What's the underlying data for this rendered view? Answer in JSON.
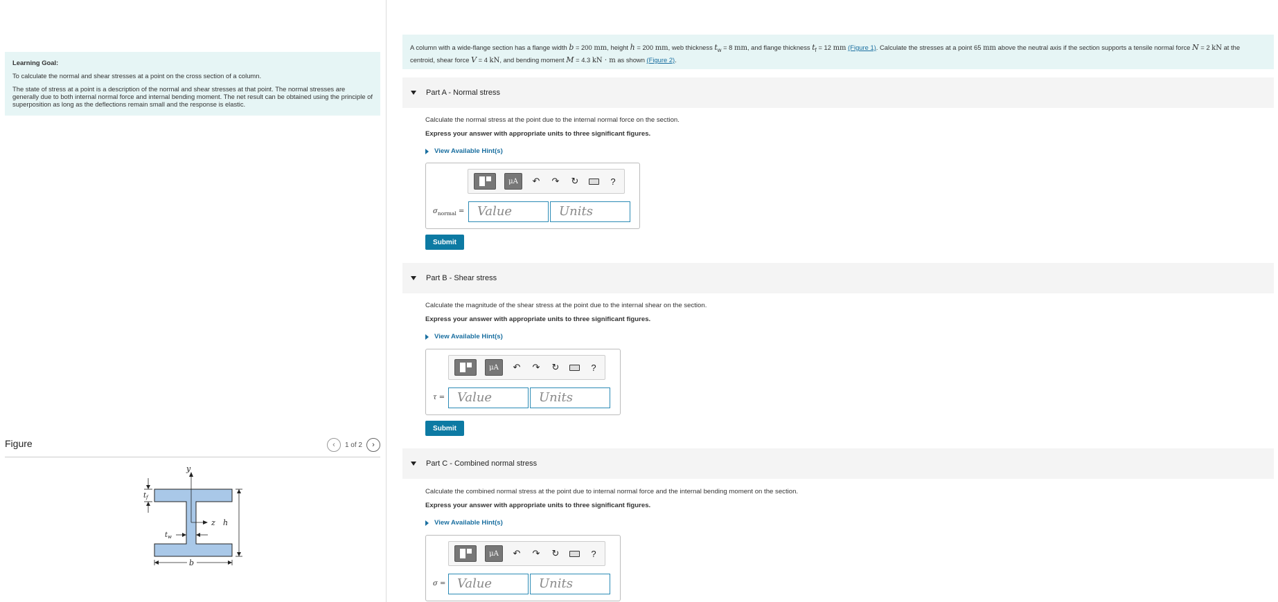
{
  "learning_goal": {
    "title": "Learning Goal:",
    "line": "To calculate the normal and shear stresses at a point on the cross section of a column.",
    "paragraph": "The state of stress at a point is a description of the normal and shear stresses at that point. The normal stresses are generally due to both internal normal force and internal bending moment. The net result can be obtained using the principle of superposition as long as the deflections remain small and the response is elastic."
  },
  "figure": {
    "title": "Figure",
    "pager": "1 of 2",
    "labels": {
      "y": "y",
      "z": "z",
      "h": "h",
      "b": "b",
      "tf": "t",
      "tf_sub": "f",
      "tw": "t",
      "tw_sub": "w"
    }
  },
  "problem": {
    "t1": "A column with a wide-flange section has a flange width",
    "b_sym": "b",
    "b_val": "= 200",
    "unit_mm": "mm",
    "t2": ", height",
    "h_sym": "h",
    "h_val": "= 200",
    "t3": ", web thickness",
    "tw_sym": "t",
    "tw_sub": "w",
    "tw_val": "= 8",
    "t4": ", and flange thickness",
    "tf_sym": "t",
    "tf_sub": "f",
    "tf_val": "= 12",
    "fig1": "(Figure 1)",
    "t5": ". Calculate the stresses at a point 65",
    "t6": "above the neutral axis if the section supports a tensile normal force",
    "N_sym": "N",
    "N_val": "= 2",
    "unit_kN": "kN",
    "t7": "at the centroid, shear force",
    "V_sym": "V",
    "V_val": "= 4",
    "t8": ", and bending moment",
    "M_sym": "M",
    "M_val": "= 4.3",
    "unit_kNm": "kN · m",
    "t9": "as shown",
    "fig2": "(Figure 2)",
    "t10": "."
  },
  "parts": [
    {
      "header": "Part A - Normal stress",
      "question": "Calculate the normal stress at the point due to the internal normal force on the section.",
      "express": "Express your answer with appropriate units to three significant figures.",
      "hint": "View Available Hint(s)",
      "var": "σ",
      "var_sub": "normal",
      "eq": "=",
      "value_placeholder": "Value",
      "units_placeholder": "Units",
      "submit": "Submit"
    },
    {
      "header": "Part B - Shear stress",
      "question": "Calculate the magnitude of the shear stress at the point due to the internal shear on the section.",
      "express": "Express your answer with appropriate units to three significant figures.",
      "hint": "View Available Hint(s)",
      "var": "τ",
      "var_sub": "",
      "eq": "=",
      "value_placeholder": "Value",
      "units_placeholder": "Units",
      "submit": "Submit"
    },
    {
      "header": "Part C - Combined normal stress",
      "question": "Calculate the combined normal stress at the point due to internal normal force and the internal bending moment on the section.",
      "express": "Express your answer with appropriate units to three significant figures.",
      "hint": "View Available Hint(s)",
      "var": "σ",
      "var_sub": "",
      "eq": "=",
      "value_placeholder": "Value",
      "units_placeholder": "Units"
    }
  ],
  "toolbar": {
    "mu_label": "μA",
    "help": "?"
  },
  "colors": {
    "accent": "#0d7aa3",
    "field_border": "#2a8ab5",
    "goal_bg": "#e6f5f5",
    "beam_fill": "#a9c8e8"
  }
}
